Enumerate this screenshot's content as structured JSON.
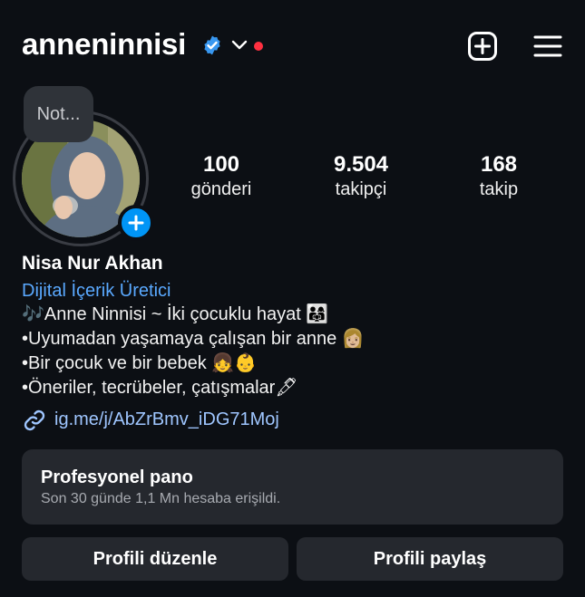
{
  "header": {
    "username": "anneninnisi",
    "icons": [
      "verified-badge-icon",
      "chevron-down-icon",
      "notification-dot",
      "add-content-icon",
      "menu-icon"
    ]
  },
  "note": {
    "text": "Not..."
  },
  "stats": [
    {
      "value": "100",
      "label": "gönderi"
    },
    {
      "value": "9.504",
      "label": "takipçi"
    },
    {
      "value": "168",
      "label": "takip"
    }
  ],
  "bio": {
    "name": "Nisa Nur Akhan",
    "category": "Dijital İçerik Üretici",
    "lines": [
      "🎶Anne Ninnisi ~ İki çocuklu hayat 👨‍👩‍👧",
      "•Uyumadan yaşamaya çalışan bir anne 👩🏼",
      "•Bir çocuk ve bir bebek 👧👶",
      "•Öneriler, tecrübeler, çatışmalar🖋"
    ],
    "link": "ig.me/j/AbZrBmv_iDG71Moj"
  },
  "dashboard": {
    "title": "Profesyonel pano",
    "subtitle": "Son 30 günde 1,1 Mn hesaba erişildi."
  },
  "buttons": {
    "edit": "Profili düzenle",
    "share": "Profili paylaş"
  },
  "colors": {
    "background": "#0c0f14",
    "accent": "#0095f6",
    "link": "#9fc6ff",
    "category": "#5aa9ff",
    "live_dot": "#ff3040",
    "card": "#25282e"
  }
}
